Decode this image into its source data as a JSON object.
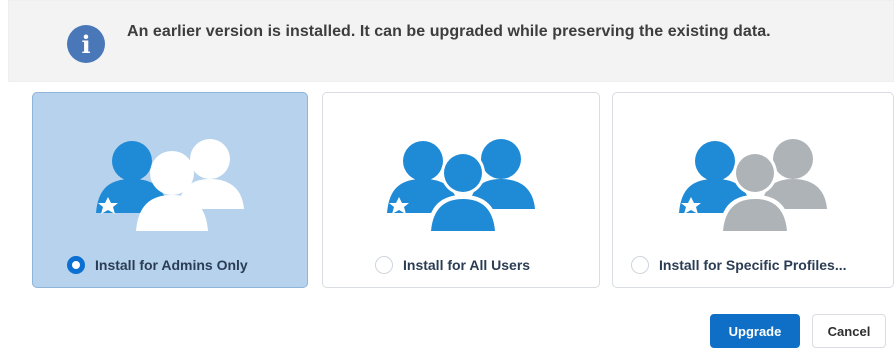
{
  "banner": {
    "icon": "info-icon",
    "text": "An earlier version is installed. It can be upgraded while preserving the existing data.",
    "icon_color": "#4a77b8"
  },
  "options": [
    {
      "label": "Install for Admins Only",
      "selected": true,
      "icon": "admin-users-icon"
    },
    {
      "label": "Install for All Users",
      "selected": false,
      "icon": "all-users-icon"
    },
    {
      "label": "Install for Specific Profiles...",
      "selected": false,
      "icon": "specific-profiles-icon"
    }
  ],
  "actions": {
    "primary_label": "Upgrade",
    "secondary_label": "Cancel"
  },
  "colors": {
    "selected_card": "#b6d2ec",
    "primary_blue": "#0f6fc7",
    "figure_blue": "#1f8ad6",
    "figure_gray": "#aeb3b7",
    "figure_white": "#ffffff"
  }
}
